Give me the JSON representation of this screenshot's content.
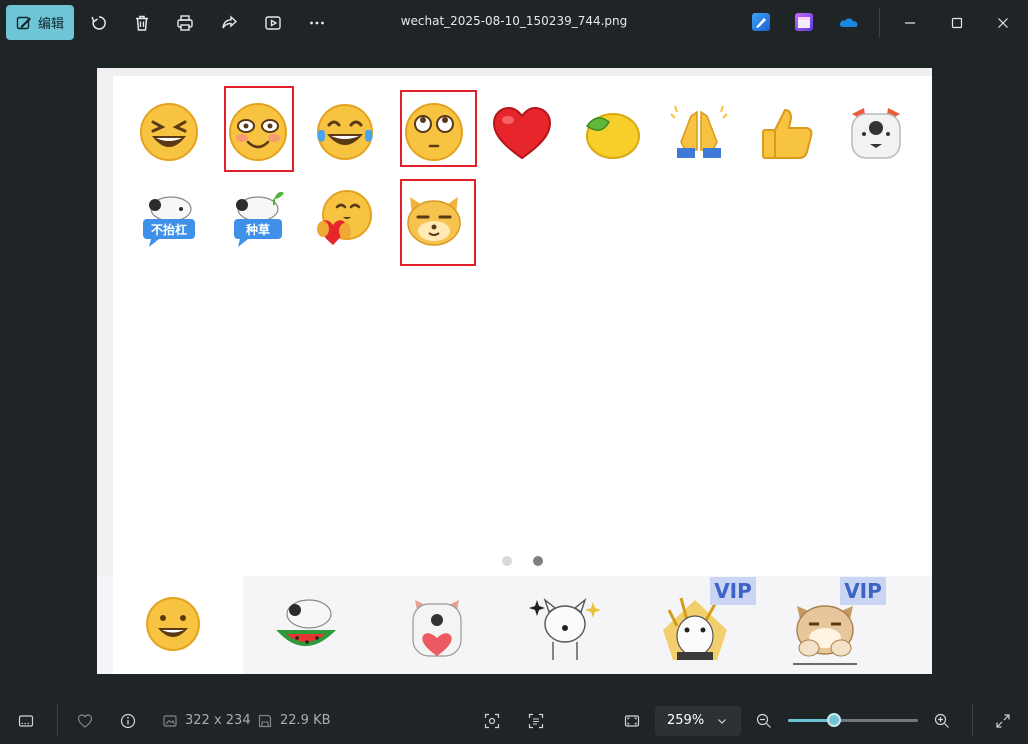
{
  "toolbar": {
    "edit_label": "编辑",
    "file_name": "wechat_2025-08-10_150239_744.png",
    "accent": "#6ec5d5"
  },
  "canvas": {
    "emoji_grid": [
      {
        "icon": "grinning-squint-face-icon",
        "highlighted": false
      },
      {
        "icon": "blushing-smile-face-icon",
        "highlighted": true
      },
      {
        "icon": "tears-of-joy-face-icon",
        "highlighted": false
      },
      {
        "icon": "eye-roll-face-icon",
        "highlighted": true
      },
      {
        "icon": "red-heart-icon",
        "highlighted": false
      },
      {
        "icon": "lemon-icon",
        "highlighted": false
      },
      {
        "icon": "folded-hands-icon",
        "highlighted": false
      },
      {
        "icon": "thumbs-up-icon",
        "highlighted": false
      },
      {
        "icon": "husky-dog-face-icon",
        "highlighted": false
      },
      {
        "icon": "cat-sticker-bu-tou-hong-icon",
        "highlighted": false
      },
      {
        "icon": "cat-sticker-zhong-cao-icon",
        "highlighted": false
      },
      {
        "icon": "hug-heart-face-icon",
        "highlighted": false
      },
      {
        "icon": "shiba-face-icon",
        "highlighted": true
      }
    ],
    "sticker_labels": [
      "不抬杠",
      "种草"
    ],
    "page_dots": 2,
    "active_page": 2,
    "tray": [
      {
        "icon": "smiley-tab-icon"
      },
      {
        "icon": "watermelon-cat-sticker-icon"
      },
      {
        "icon": "husky-heart-sticker-icon"
      },
      {
        "icon": "sparkle-cat-sticker-icon"
      },
      {
        "icon": "cat-vip-sticker-icon",
        "badge": "VIP"
      },
      {
        "icon": "shiba-vip-sticker-icon",
        "badge": "VIP"
      }
    ],
    "highlight_color": "#e0202a"
  },
  "status": {
    "dimensions": "322 x 234",
    "file_size": "22.9 KB",
    "zoom": "259%",
    "zoom_fraction": 0.35
  }
}
